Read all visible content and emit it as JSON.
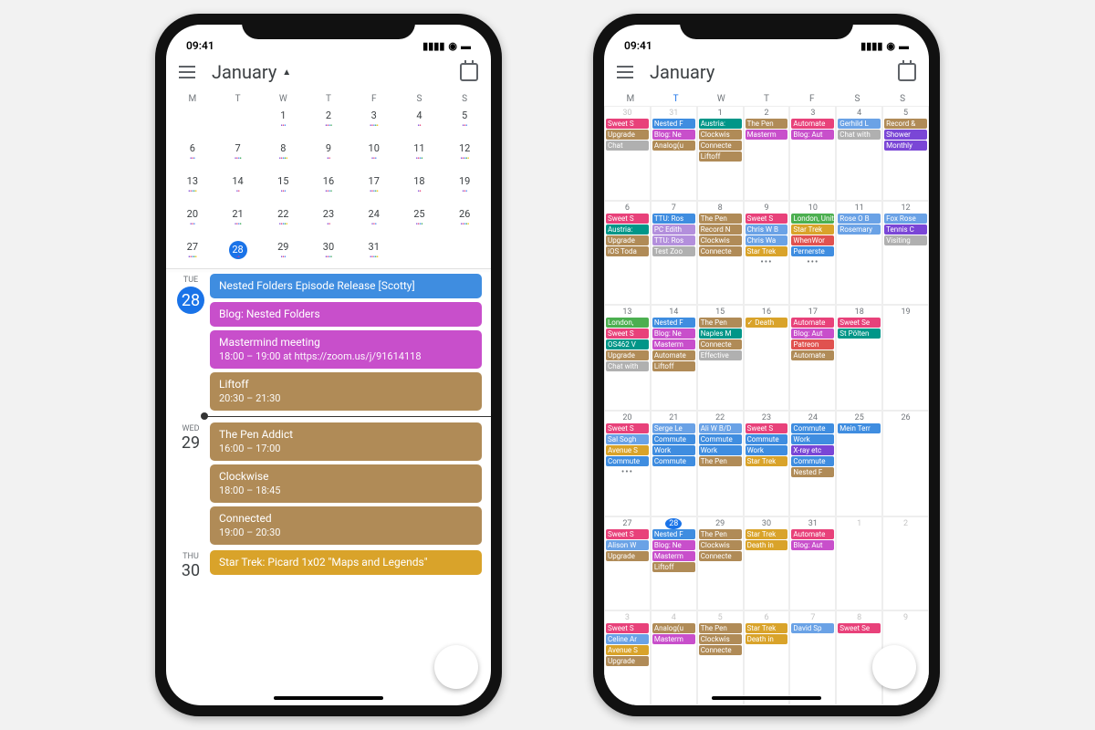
{
  "status": {
    "time": "09:41"
  },
  "header": {
    "month": "January"
  },
  "dow": [
    "M",
    "T",
    "W",
    "T",
    "F",
    "S",
    "S"
  ],
  "left": {
    "mini_weeks": [
      [
        "",
        "",
        "1",
        "2",
        "3",
        "4",
        "5"
      ],
      [
        "6",
        "7",
        "8",
        "9",
        "10",
        "11",
        "12"
      ],
      [
        "13",
        "14",
        "15",
        "16",
        "17",
        "18",
        "19"
      ],
      [
        "20",
        "21",
        "22",
        "23",
        "24",
        "25",
        "26"
      ],
      [
        "27",
        "28",
        "29",
        "30",
        "31",
        "",
        ""
      ]
    ],
    "selected": "28",
    "agenda": [
      {
        "dow": "TUE",
        "num": "28",
        "today": true,
        "events": [
          {
            "title": "Nested Folders Episode Release [Scotty]",
            "c": "c-blue"
          },
          {
            "title": "Blog: Nested Folders",
            "c": "c-mag"
          },
          {
            "title": "Mastermind meeting",
            "sub": "18:00 – 19:00 at https://zoom.us/j/91614118",
            "c": "c-mag"
          },
          {
            "title": "Liftoff",
            "sub": "20:30 – 21:30",
            "c": "c-tan"
          }
        ]
      },
      {
        "dow": "WED",
        "num": "29",
        "events": [
          {
            "title": "The Pen Addict",
            "sub": "16:00 – 17:00",
            "c": "c-tan"
          },
          {
            "title": "Clockwise",
            "sub": "18:00 – 18:45",
            "c": "c-tan"
          },
          {
            "title": "Connected",
            "sub": "19:00 – 20:30",
            "c": "c-tan"
          }
        ]
      },
      {
        "dow": "THU",
        "num": "30",
        "events": [
          {
            "title": "Star Trek: Picard 1x02 \"Maps and Legends\"",
            "c": "c-gold"
          }
        ]
      }
    ]
  },
  "right": {
    "weeks": [
      {
        "days": [
          {
            "n": "30",
            "dim": true,
            "ev": [
              [
                "Sweet S",
                "c-pink"
              ],
              [
                "Upgrade",
                "c-tan"
              ],
              [
                "Chat",
                "c-gry"
              ]
            ]
          },
          {
            "n": "31",
            "dim": true,
            "ev": [
              [
                "Nested F",
                "c-blue"
              ],
              [
                "Blog: Ne",
                "c-mag"
              ],
              [
                "Analog(u",
                "c-tan"
              ]
            ]
          },
          {
            "n": "1",
            "ev": [
              [
                "Austria:",
                "c-teal"
              ],
              [
                "Clockwis",
                "c-tan"
              ],
              [
                "Connecte",
                "c-tan"
              ],
              [
                "Liftoff",
                "c-tan"
              ]
            ]
          },
          {
            "n": "2",
            "ev": [
              [
                "The Pen",
                "c-tan"
              ],
              [
                "Masterm",
                "c-mag"
              ]
            ]
          },
          {
            "n": "3",
            "ev": [
              [
                "Automate",
                "c-pink"
              ],
              [
                "Blog: Aut",
                "c-mag"
              ]
            ]
          },
          {
            "n": "4",
            "ev": [
              [
                "Gerhild L",
                "c-blue2"
              ],
              [
                "Chat with",
                "c-gry"
              ]
            ]
          },
          {
            "n": "5",
            "ev": [
              [
                "Record &",
                "c-tan"
              ],
              [
                "Shower",
                "c-pur"
              ],
              [
                "Monthly",
                "c-pur"
              ]
            ]
          }
        ]
      },
      {
        "days": [
          {
            "n": "6",
            "ev": [
              [
                "Sweet S",
                "c-pink"
              ],
              [
                "Austria:",
                "c-teal"
              ],
              [
                "Upgrade",
                "c-tan"
              ],
              [
                "iOS Toda",
                "c-tan"
              ]
            ]
          },
          {
            "n": "7",
            "today_col": true,
            "ev": [
              [
                "TTU: Ros",
                "c-blue"
              ],
              [
                "PC Edith",
                "c-lav"
              ],
              [
                "TTU: Ros",
                "c-lav"
              ],
              [
                "Test Zoo",
                "c-gry"
              ]
            ]
          },
          {
            "n": "8",
            "ev": [
              [
                "The Pen",
                "c-tan"
              ],
              [
                "Record N",
                "c-tan"
              ],
              [
                "Clockwis",
                "c-tan"
              ],
              [
                "Connecte",
                "c-tan"
              ]
            ]
          },
          {
            "n": "9",
            "ev": [
              [
                "Sweet S",
                "c-pink"
              ],
              [
                "Chris W B",
                "c-blue2"
              ],
              [
                "Chris Wa",
                "c-blue2"
              ],
              [
                "Star Trek",
                "c-gold"
              ]
            ],
            "more": true
          },
          {
            "n": "10",
            "span": [
              [
                "London, United Kingdom, Janu",
                "c-grn",
                3
              ]
            ],
            "ev": [
              [
                "Star Trek",
                "c-gold"
              ],
              [
                "WhenWor",
                "c-red"
              ],
              [
                "Pernerste",
                "c-blue"
              ]
            ],
            "more": true
          },
          {
            "n": "11",
            "ev": [
              [
                "Rose O B",
                "c-blue2"
              ],
              [
                "Rosemary",
                "c-blue2"
              ]
            ]
          },
          {
            "n": "12",
            "ev": [
              [
                "Fox Rose",
                "c-blue2"
              ],
              [
                "Tennis C",
                "c-pur"
              ],
              [
                "Visiting",
                "c-gry"
              ]
            ]
          }
        ]
      },
      {
        "days": [
          {
            "n": "13",
            "ev": [
              [
                "London,",
                "c-grn"
              ],
              [
                "Sweet S",
                "c-pink"
              ],
              [
                "OS462 V",
                "c-teal"
              ],
              [
                "Upgrade",
                "c-tan"
              ],
              [
                "Chat with",
                "c-gry"
              ]
            ]
          },
          {
            "n": "14",
            "ev": [
              [
                "Nested F",
                "c-blue"
              ],
              [
                "Blog: Ne",
                "c-mag"
              ],
              [
                "Masterm",
                "c-mag"
              ],
              [
                "Automate",
                "c-tan"
              ],
              [
                "Liftoff",
                "c-tan"
              ]
            ]
          },
          {
            "n": "15",
            "ev": [
              [
                "The Pen",
                "c-tan"
              ],
              [
                "Naples M",
                "c-teal"
              ],
              [
                "Connecte",
                "c-tan"
              ],
              [
                "Effective",
                "c-gry"
              ]
            ]
          },
          {
            "n": "16",
            "ev": [
              [
                "✓ Death",
                "c-gold"
              ]
            ]
          },
          {
            "n": "17",
            "ev": [
              [
                "Automate",
                "c-pink"
              ],
              [
                "Blog: Aut",
                "c-mag"
              ],
              [
                "Patreon",
                "c-red"
              ],
              [
                "Automate",
                "c-tan"
              ]
            ]
          },
          {
            "n": "18",
            "ev": [
              [
                "Sweet Se",
                "c-pink"
              ],
              [
                "St Pölten",
                "c-teal"
              ]
            ]
          },
          {
            "n": "19",
            "ev": []
          }
        ]
      },
      {
        "days": [
          {
            "n": "20",
            "ev": [
              [
                "Sweet S",
                "c-pink"
              ],
              [
                "Sal Sogh",
                "c-blue2"
              ],
              [
                "Avenue S",
                "c-gold"
              ],
              [
                "Commute",
                "c-blue"
              ]
            ],
            "more": true
          },
          {
            "n": "21",
            "ev": [
              [
                "Serge Le",
                "c-blue2"
              ],
              [
                "Commute",
                "c-blue"
              ],
              [
                "Work",
                "c-blue"
              ],
              [
                "Commute",
                "c-blue"
              ]
            ]
          },
          {
            "n": "22",
            "ev": [
              [
                "Ali W B/D",
                "c-blue2"
              ],
              [
                "Commute",
                "c-blue"
              ],
              [
                "Work",
                "c-blue"
              ],
              [
                "The Pen",
                "c-tan"
              ]
            ]
          },
          {
            "n": "23",
            "ev": [
              [
                "Sweet S",
                "c-pink"
              ],
              [
                "Commute",
                "c-blue"
              ],
              [
                "Work",
                "c-blue"
              ],
              [
                "Star Trek",
                "c-gold"
              ]
            ]
          },
          {
            "n": "24",
            "ev": [
              [
                "Commute",
                "c-blue"
              ],
              [
                "Work",
                "c-blue"
              ],
              [
                "X-ray etc",
                "c-pur"
              ],
              [
                "Commute",
                "c-blue"
              ],
              [
                "Nested F",
                "c-tan"
              ]
            ]
          },
          {
            "n": "25",
            "ev": [
              [
                "Mein Terr",
                "c-blue"
              ]
            ]
          },
          {
            "n": "26",
            "ev": []
          }
        ]
      },
      {
        "days": [
          {
            "n": "27",
            "ev": [
              [
                "Sweet S",
                "c-pink"
              ],
              [
                "Alison W",
                "c-blue2"
              ],
              [
                "Upgrade",
                "c-tan"
              ]
            ]
          },
          {
            "n": "28",
            "today": true,
            "ev": [
              [
                "Nested F",
                "c-blue"
              ],
              [
                "Blog: Ne",
                "c-mag"
              ],
              [
                "Masterm",
                "c-mag"
              ],
              [
                "Liftoff",
                "c-tan"
              ]
            ]
          },
          {
            "n": "29",
            "ev": [
              [
                "The Pen",
                "c-tan"
              ],
              [
                "Clockwis",
                "c-tan"
              ],
              [
                "Connecte",
                "c-tan"
              ]
            ]
          },
          {
            "n": "30",
            "ev": [
              [
                "Star Trek",
                "c-gold"
              ],
              [
                "Death in",
                "c-gold"
              ]
            ]
          },
          {
            "n": "31",
            "ev": [
              [
                "Automate",
                "c-pink"
              ],
              [
                "Blog: Aut",
                "c-mag"
              ]
            ]
          },
          {
            "n": "1",
            "dim": true,
            "ev": []
          },
          {
            "n": "2",
            "dim": true,
            "ev": []
          }
        ]
      },
      {
        "days": [
          {
            "n": "3",
            "dim": true,
            "ev": [
              [
                "Sweet S",
                "c-pink"
              ],
              [
                "Celine Ar",
                "c-blue2"
              ],
              [
                "Avenue S",
                "c-gold"
              ],
              [
                "Upgrade",
                "c-tan"
              ]
            ]
          },
          {
            "n": "4",
            "dim": true,
            "ev": [
              [
                "Analog(u",
                "c-tan"
              ],
              [
                "Masterm",
                "c-mag"
              ]
            ]
          },
          {
            "n": "5",
            "dim": true,
            "ev": [
              [
                "The Pen",
                "c-tan"
              ],
              [
                "Clockwis",
                "c-tan"
              ],
              [
                "Connecte",
                "c-tan"
              ]
            ]
          },
          {
            "n": "6",
            "dim": true,
            "ev": [
              [
                "Star Trek",
                "c-gold"
              ],
              [
                "Death in",
                "c-gold"
              ]
            ]
          },
          {
            "n": "7",
            "dim": true,
            "ev": [
              [
                "David Sp",
                "c-blue2"
              ]
            ]
          },
          {
            "n": "8",
            "dim": true,
            "ev": [
              [
                "Sweet Se",
                "c-pink"
              ]
            ]
          },
          {
            "n": "9",
            "dim": true,
            "ev": []
          }
        ]
      }
    ]
  }
}
